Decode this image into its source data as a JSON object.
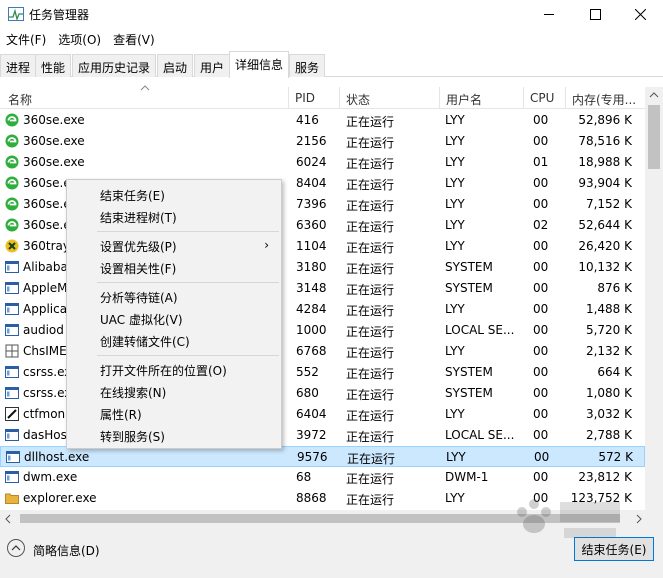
{
  "window": {
    "title": "任务管理器"
  },
  "menubar": [
    {
      "label": "文件(F)"
    },
    {
      "label": "选项(O)"
    },
    {
      "label": "查看(V)"
    }
  ],
  "tabs": [
    {
      "label": "进程"
    },
    {
      "label": "性能"
    },
    {
      "label": "应用历史记录"
    },
    {
      "label": "启动"
    },
    {
      "label": "用户"
    },
    {
      "label": "详细信息",
      "active": true
    },
    {
      "label": "服务"
    }
  ],
  "table": {
    "columns": [
      {
        "label": "名称"
      },
      {
        "label": "PID"
      },
      {
        "label": "状态"
      },
      {
        "label": "用户名"
      },
      {
        "label": "CPU"
      },
      {
        "label": "内存(专用..."
      }
    ],
    "rows": [
      {
        "name": "360se.exe",
        "pid": "416",
        "status": "正在运行",
        "user": "LYY",
        "cpu": "00",
        "mem": "52,896 K",
        "icon": "360se-icon"
      },
      {
        "name": "360se.exe",
        "pid": "2156",
        "status": "正在运行",
        "user": "LYY",
        "cpu": "00",
        "mem": "78,516 K",
        "icon": "360se-icon"
      },
      {
        "name": "360se.exe",
        "pid": "6024",
        "status": "正在运行",
        "user": "LYY",
        "cpu": "01",
        "mem": "18,988 K",
        "icon": "360se-icon"
      },
      {
        "name": "360se.e",
        "pid": "8404",
        "status": "正在运行",
        "user": "LYY",
        "cpu": "00",
        "mem": "93,904 K",
        "icon": "360se-icon"
      },
      {
        "name": "360se.e",
        "pid": "7396",
        "status": "正在运行",
        "user": "LYY",
        "cpu": "00",
        "mem": "7,152 K",
        "icon": "360se-icon"
      },
      {
        "name": "360se.e",
        "pid": "6360",
        "status": "正在运行",
        "user": "LYY",
        "cpu": "02",
        "mem": "52,644 K",
        "icon": "360se-icon"
      },
      {
        "name": "360tray",
        "pid": "1104",
        "status": "正在运行",
        "user": "LYY",
        "cpu": "00",
        "mem": "26,420 K",
        "icon": "360tray-icon"
      },
      {
        "name": "Alibaba",
        "pid": "3180",
        "status": "正在运行",
        "user": "SYSTEM",
        "cpu": "00",
        "mem": "10,132 K",
        "icon": "app-window-icon"
      },
      {
        "name": "AppleM",
        "pid": "3148",
        "status": "正在运行",
        "user": "SYSTEM",
        "cpu": "00",
        "mem": "876 K",
        "icon": "app-window-icon"
      },
      {
        "name": "Applica",
        "pid": "4284",
        "status": "正在运行",
        "user": "LYY",
        "cpu": "00",
        "mem": "1,488 K",
        "icon": "app-window-icon"
      },
      {
        "name": "audiod",
        "pid": "1000",
        "status": "正在运行",
        "user": "LOCAL SE...",
        "cpu": "00",
        "mem": "5,720 K",
        "icon": "app-window-icon"
      },
      {
        "name": "ChsIME",
        "pid": "6768",
        "status": "正在运行",
        "user": "LYY",
        "cpu": "00",
        "mem": "2,132 K",
        "icon": "ime-icon"
      },
      {
        "name": "csrss.ex",
        "pid": "552",
        "status": "正在运行",
        "user": "SYSTEM",
        "cpu": "00",
        "mem": "664 K",
        "icon": "app-window-icon"
      },
      {
        "name": "csrss.ex",
        "pid": "680",
        "status": "正在运行",
        "user": "SYSTEM",
        "cpu": "00",
        "mem": "1,080 K",
        "icon": "app-window-icon"
      },
      {
        "name": "ctfmon.",
        "pid": "6404",
        "status": "正在运行",
        "user": "LYY",
        "cpu": "00",
        "mem": "3,032 K",
        "icon": "pen-icon"
      },
      {
        "name": "dasHost",
        "pid": "3972",
        "status": "正在运行",
        "user": "LOCAL SE...",
        "cpu": "00",
        "mem": "2,788 K",
        "icon": "app-window-icon"
      },
      {
        "name": "dllhost.exe",
        "pid": "9576",
        "status": "正在运行",
        "user": "LYY",
        "cpu": "00",
        "mem": "572 K",
        "icon": "app-window-icon",
        "selected": true
      },
      {
        "name": "dwm.exe",
        "pid": "68",
        "status": "正在运行",
        "user": "DWM-1",
        "cpu": "00",
        "mem": "23,812 K",
        "icon": "app-window-icon"
      },
      {
        "name": "explorer.exe",
        "pid": "8868",
        "status": "正在运行",
        "user": "LYY",
        "cpu": "00",
        "mem": "123,752 K",
        "icon": "folder-icon"
      }
    ]
  },
  "context_menu": {
    "items": [
      {
        "label": "结束任务(E)"
      },
      {
        "label": "结束进程树(T)"
      },
      {
        "label": "设置优先级(P)",
        "submenu": true
      },
      {
        "label": "设置相关性(F)"
      },
      {
        "label": "分析等待链(A)"
      },
      {
        "label": "UAC 虚拟化(V)"
      },
      {
        "label": "创建转储文件(C)"
      },
      {
        "label": "打开文件所在的位置(O)"
      },
      {
        "label": "在线搜索(N)"
      },
      {
        "label": "属性(R)"
      },
      {
        "label": "转到服务(S)"
      }
    ],
    "submenu_arrow": "›"
  },
  "footer": {
    "fewer_details": "简略信息(D)",
    "end_task": "结束任务(E)"
  },
  "colors": {
    "selected_row": "#cce8ff",
    "accent": "#0078d7",
    "green_icon": "#2eae3c",
    "folder": "#e8b33c"
  }
}
